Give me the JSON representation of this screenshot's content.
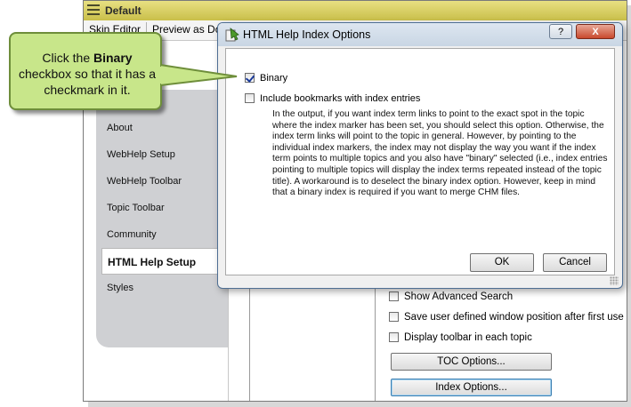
{
  "editor": {
    "title": "Default",
    "toolbar": [
      "Skin Editor",
      "Preview as Do"
    ],
    "nav_items": [
      "About",
      "WebHelp Setup",
      "WebHelp Toolbar",
      "Topic Toolbar",
      "Community",
      "HTML Help Setup",
      "Styles"
    ],
    "selected_nav": "HTML Help Setup",
    "checkboxes": [
      {
        "label": "Show Advanced Search",
        "checked": false
      },
      {
        "label": "Save user defined window position after first use",
        "checked": false
      },
      {
        "label": "Display toolbar in each topic",
        "checked": false
      }
    ],
    "toc_button": "TOC Options...",
    "index_button": "Index Options..."
  },
  "dialog": {
    "title": "HTML Help Index Options",
    "help_button": "?",
    "close_button": "X",
    "binary_label": "Binary",
    "binary_checked": true,
    "bookmarks_label": "Include bookmarks with index entries",
    "bookmarks_checked": false,
    "description": "In the output, if you want index term links to point to the exact spot in the topic where the index marker has been set, you should select this option. Otherwise, the index term links will point to the topic in general. However, by pointing to the individual index markers, the index may not display the way you want if the index term points to multiple topics and you also have \"binary\" selected (i.e., index entries pointing to multiple topics will display the index terms repeated instead of the topic title). A workaround is to deselect the binary index option. However, keep in mind that a binary index is required if you want to merge CHM files.",
    "ok_button": "OK",
    "cancel_button": "Cancel"
  },
  "callout": {
    "prefix": "Click the ",
    "bold": "Binary",
    "suffix": " checkbox so that it has a checkmark in it."
  },
  "colors": {
    "callout_fill": "#c8e68a",
    "titlebar": "#d8cf5c",
    "dialog_border": "#4e6e93"
  }
}
